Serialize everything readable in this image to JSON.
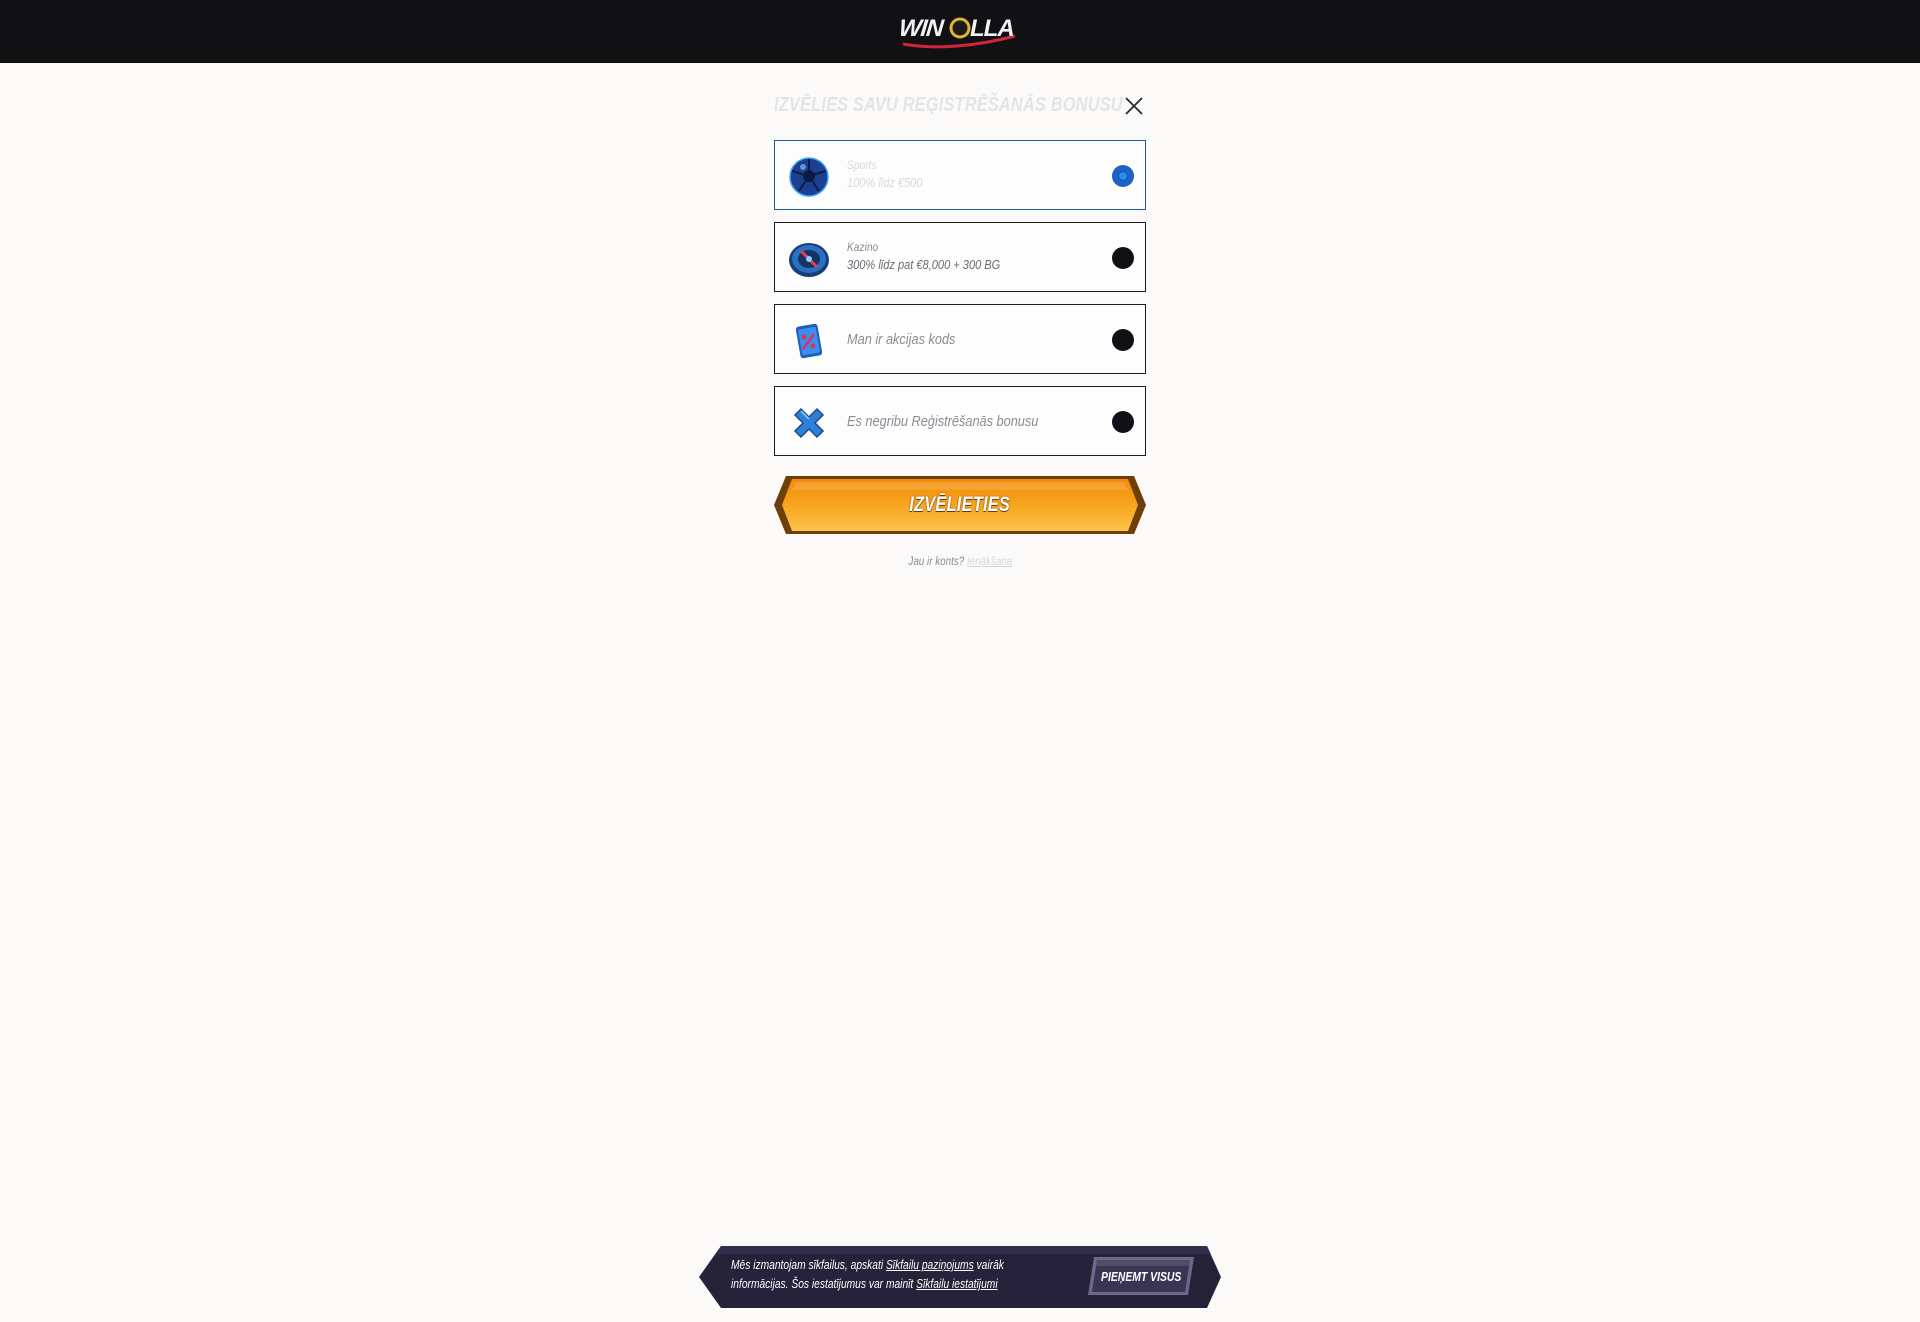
{
  "header": {
    "logo_text": "WINROLLA"
  },
  "modal": {
    "title": "IZVĒLIES SAVU REĢISTRĒŠANĀS BONUSU",
    "close_icon": "close-icon",
    "options": [
      {
        "label": "Sports",
        "sub": "100% līdz €500",
        "icon": "football-icon",
        "selected": true
      },
      {
        "label": "Kazino",
        "sub": "300% līdz pat €8,000 + 300 BG",
        "icon": "casino-chip-icon",
        "selected": false
      },
      {
        "label": "Man ir akcijas kods",
        "icon": "promo-tag-icon",
        "selected": false
      },
      {
        "label": "Es negribu Reģistrēšanās bonusu",
        "icon": "cross-icon",
        "selected": false
      }
    ],
    "choose_button": "IZVĒLIETIES",
    "login_prompt": "Jau ir konts?",
    "login_link": "Ienākšana"
  },
  "cookie_banner": {
    "text_1": "Mēs izmantojam sīkfailus, apskati",
    "link_1": "Sīkfailu paziņojums",
    "text_2": "vairāk informācijas. Šos iestatījumus var mainīt",
    "link_2": "Sīkfailu iestatījumi",
    "accept_button": "PIEŅEMT VISUS"
  },
  "colors": {
    "topbar": "#111013",
    "accent_orange": "#f59b0f",
    "selected_blue": "#1a63c5",
    "cookie_bg": "#26223a"
  }
}
